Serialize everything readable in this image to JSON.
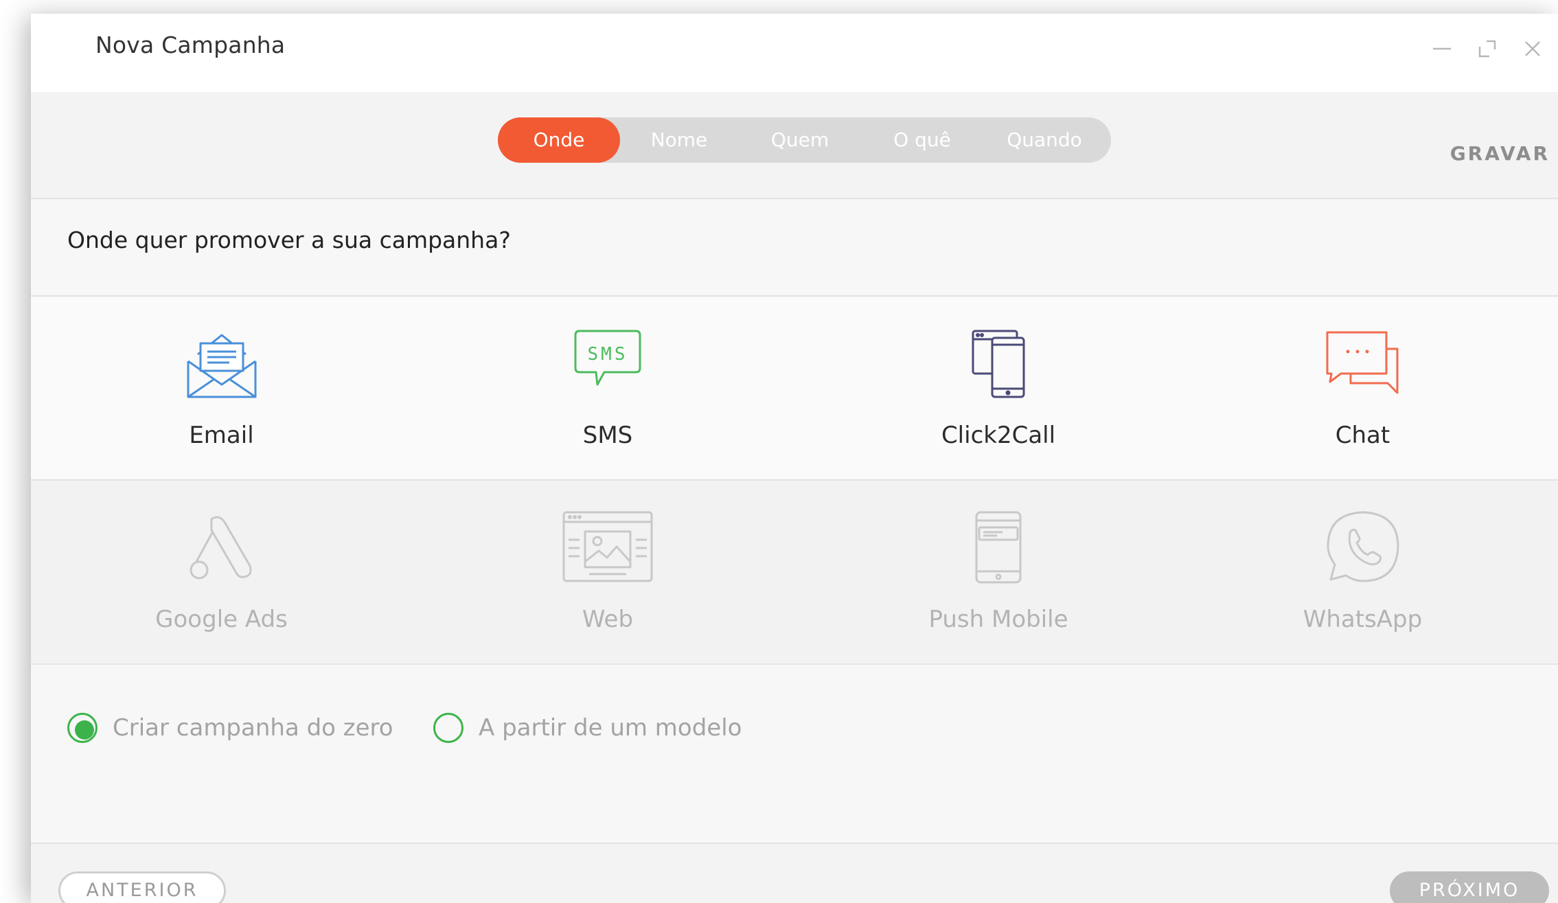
{
  "window": {
    "title": "Nova Campanha"
  },
  "steps": {
    "items": [
      {
        "label": "Onde",
        "active": true
      },
      {
        "label": "Nome",
        "active": false
      },
      {
        "label": "Quem",
        "active": false
      },
      {
        "label": "O quê",
        "active": false
      },
      {
        "label": "Quando",
        "active": false
      }
    ],
    "save_label": "GRAVAR"
  },
  "main": {
    "question": "Onde quer promover a sua campanha?",
    "channels": [
      {
        "label": "Email",
        "icon": "email-icon",
        "enabled": true,
        "color": "#4a90d9"
      },
      {
        "label": "SMS",
        "icon": "sms-icon",
        "enabled": true,
        "color": "#4cbb5d"
      },
      {
        "label": "Click2Call",
        "icon": "click2call-icon",
        "enabled": true,
        "color": "#4a4a78"
      },
      {
        "label": "Chat",
        "icon": "chat-icon",
        "enabled": true,
        "color": "#f26b4f"
      },
      {
        "label": "Google Ads",
        "icon": "google-ads-icon",
        "enabled": false
      },
      {
        "label": "Web",
        "icon": "web-icon",
        "enabled": false
      },
      {
        "label": "Push Mobile",
        "icon": "push-mobile-icon",
        "enabled": false
      },
      {
        "label": "WhatsApp",
        "icon": "whatsapp-icon",
        "enabled": false
      }
    ],
    "options": [
      {
        "label": "Criar campanha do zero",
        "selected": true
      },
      {
        "label": "A partir de um modelo",
        "selected": false
      }
    ]
  },
  "footer": {
    "prev_label": "ANTERIOR",
    "next_label": "PRÓXIMO"
  },
  "colors": {
    "accent": "#f25a33",
    "radio": "#3bb34a",
    "disabled_button": "#bdbdbd"
  }
}
